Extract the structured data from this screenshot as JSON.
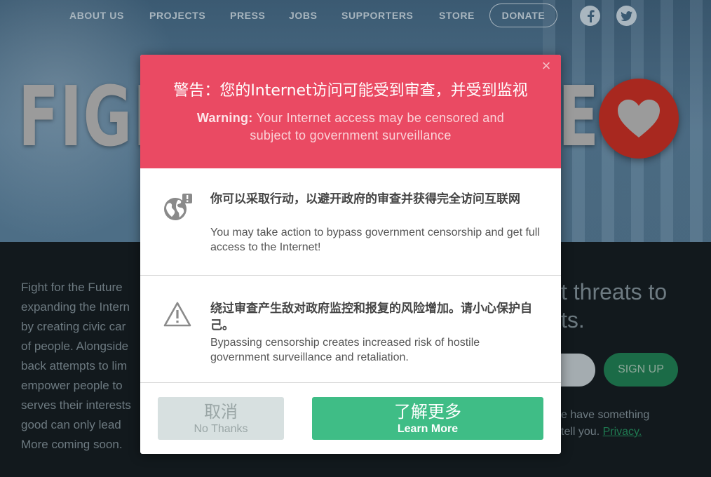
{
  "nav": {
    "links": [
      "ABOUT US",
      "PROJECTS",
      "PRESS",
      "JOBS",
      "SUPPORTERS",
      "STORE"
    ],
    "donate": "DONATE",
    "social_icons": [
      "facebook-icon",
      "twitter-icon"
    ]
  },
  "hero": {
    "title_left": "FIGH",
    "title_right": "E"
  },
  "body": {
    "left_lines": [
      "Fight for the Future",
      "expanding the Intern",
      "by creating civic car",
      "of people. Alongside",
      "back attempts to lim",
      "empower people to",
      "serves their interests",
      "good can only lead",
      "More coming soon."
    ],
    "right_heading_line1": "t threats to",
    "right_heading_line2": "ts.",
    "signup": "SIGN UP",
    "privacy_line1": "e have something",
    "privacy_line2": "tell you.",
    "privacy_link": "Privacy."
  },
  "modal": {
    "close": "×",
    "title_zh": "警告：您的Internet访问可能受到审查，并受到监视",
    "subtitle_bold": "Warning:",
    "subtitle_rest": "Your Internet access may be censored and subject to government surveillance",
    "section1": {
      "icon": "globe-alert-icon",
      "zh": "你可以采取行动，以避开政府的审查并获得完全访问互联网",
      "en": "You may take action to bypass government censorship and get full access to the Internet!"
    },
    "section2": {
      "icon": "warning-triangle-icon",
      "zh": "绕过审查产生敌对政府监控和报复的风险增加。请小心保护自己。",
      "en": "Bypassing censorship creates increased risk of hostile government surveillance and retaliation."
    },
    "cancel_zh": "取消",
    "cancel_en": "No Thanks",
    "learn_zh": "了解更多",
    "learn_en": "Learn More"
  },
  "colors": {
    "header_red": "#ea4a63",
    "learn_green": "#3fbd86",
    "cancel_gray": "#d7e0e0",
    "heart_red": "#a8281f"
  }
}
